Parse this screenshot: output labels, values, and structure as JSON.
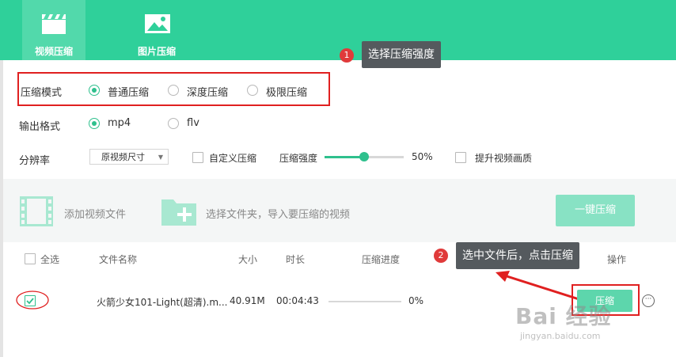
{
  "tabs": [
    {
      "label": "视频压缩",
      "icon": "film-clapper-icon",
      "active": true
    },
    {
      "label": "图片压缩",
      "icon": "image-icon",
      "active": false
    }
  ],
  "callouts": [
    {
      "number": "1",
      "text": "选择压缩强度"
    },
    {
      "number": "2",
      "text": "选中文件后，点击压缩"
    }
  ],
  "compress_mode": {
    "label": "压缩模式",
    "options": [
      "普通压缩",
      "深度压缩",
      "极限压缩"
    ],
    "selected": 0
  },
  "output_format": {
    "label": "输出格式",
    "options": [
      "mp4",
      "flv"
    ],
    "selected": 0
  },
  "resolution": {
    "label": "分辨率",
    "value": "原视频尺寸",
    "custom_label": "自定义压缩",
    "strength_label": "压缩强度",
    "strength_value": "50%",
    "strength_fraction": 0.5,
    "enhance_label": "提升视频画质"
  },
  "toolbar": {
    "add_file_label": "添加视频文件",
    "add_folder_label": "选择文件夹，导入要压缩的视频",
    "compress_all_label": "一键压缩"
  },
  "table": {
    "headers": {
      "select_all": "全选",
      "name": "文件名称",
      "size": "大小",
      "duration": "时长",
      "progress": "压缩进度",
      "action": "操作"
    },
    "rows": [
      {
        "name": "火箭少女101-Light(超清).m...",
        "size": "40.91M",
        "duration": "00:04:43",
        "progress_text": "0%",
        "progress_fraction": 0,
        "checked": true,
        "action_label": "压缩"
      }
    ]
  },
  "watermark": {
    "brand": "Bai 经验",
    "url": "jingyan.baidu.com"
  },
  "colors": {
    "accent": "#2fd09a",
    "callout_bg": "#555a5e",
    "badge": "#e03a3a",
    "highlight": "#e02020"
  }
}
